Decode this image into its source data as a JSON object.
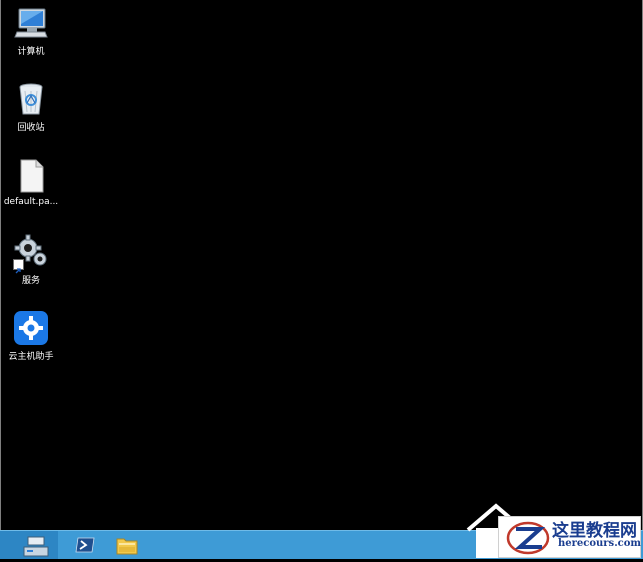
{
  "desktop": {
    "background_color": "#000000",
    "icons": [
      {
        "label": "计算机",
        "icon": "computer-icon"
      },
      {
        "label": "回收站",
        "icon": "recycle-bin-icon"
      },
      {
        "label": "default.pa...",
        "icon": "document-icon"
      },
      {
        "label": "服务",
        "icon": "services-gear-icon"
      },
      {
        "label": "云主机助手",
        "icon": "cloud-host-assistant-icon"
      }
    ]
  },
  "taskbar": {
    "color": "#3e9bd6",
    "apps": [
      {
        "icon": "server-manager-icon"
      },
      {
        "icon": "powershell-icon"
      },
      {
        "icon": "file-explorer-icon"
      }
    ]
  },
  "watermark": {
    "title": "这里教程网",
    "url": "herecours.com"
  }
}
